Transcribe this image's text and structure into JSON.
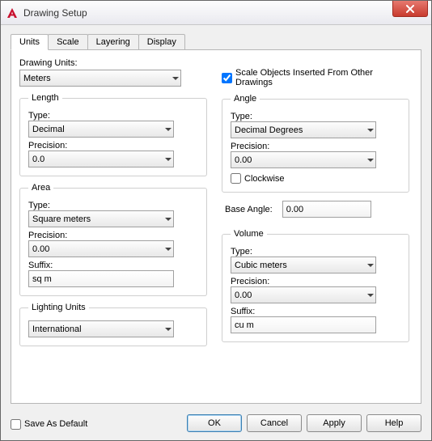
{
  "window": {
    "title": "Drawing Setup"
  },
  "tabs": {
    "units": "Units",
    "scale": "Scale",
    "layering": "Layering",
    "display": "Display"
  },
  "left": {
    "drawing_units_label": "Drawing Units:",
    "drawing_units_value": "Meters",
    "length": {
      "legend": "Length",
      "type_label": "Type:",
      "type_value": "Decimal",
      "precision_label": "Precision:",
      "precision_value": "0.0"
    },
    "area": {
      "legend": "Area",
      "type_label": "Type:",
      "type_value": "Square meters",
      "precision_label": "Precision:",
      "precision_value": "0.00",
      "suffix_label": "Suffix:",
      "suffix_value": "sq m"
    },
    "lighting": {
      "legend": "Lighting Units",
      "value": "International"
    }
  },
  "right": {
    "scale_objects_label": "Scale Objects Inserted From Other Drawings",
    "angle": {
      "legend": "Angle",
      "type_label": "Type:",
      "type_value": "Decimal Degrees",
      "precision_label": "Precision:",
      "precision_value": "0.00",
      "clockwise_label": "Clockwise"
    },
    "base_angle_label": "Base Angle:",
    "base_angle_value": "0.00",
    "volume": {
      "legend": "Volume",
      "type_label": "Type:",
      "type_value": "Cubic meters",
      "precision_label": "Precision:",
      "precision_value": "0.00",
      "suffix_label": "Suffix:",
      "suffix_value": "cu m"
    }
  },
  "footer": {
    "save_default_label": "Save As Default",
    "ok": "OK",
    "cancel": "Cancel",
    "apply": "Apply",
    "help": "Help"
  }
}
